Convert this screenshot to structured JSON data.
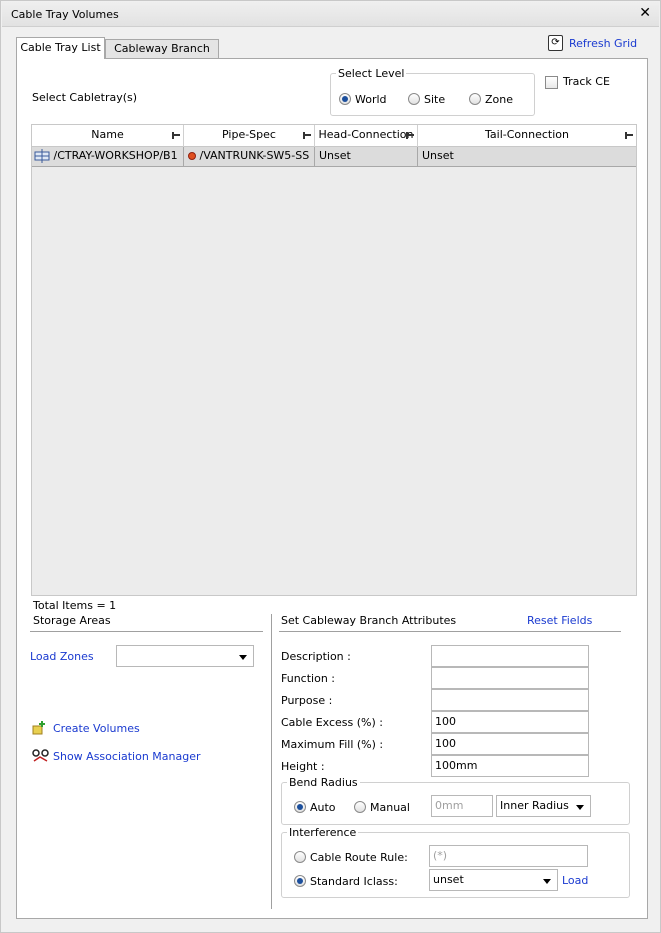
{
  "window": {
    "title": "Cable Tray Volumes"
  },
  "tabs": [
    {
      "label": "Cable Tray List",
      "active": true
    },
    {
      "label": "Cableway Branch List",
      "active": false
    }
  ],
  "refresh_label": "Refresh Grid",
  "select_cabletray_label": "Select Cabletray(s)",
  "select_level": {
    "title": "Select Level",
    "options": [
      "World",
      "Site",
      "Zone"
    ],
    "selected": "World"
  },
  "track_ce_label": "Track CE",
  "grid": {
    "columns": [
      "Name",
      "Pipe-Spec",
      "Head-Connection",
      "Tail-Connection"
    ],
    "rows": [
      {
        "name": "/CTRAY-WORKSHOP/B1",
        "pipe_spec": "/VANTRUNK-SW5-SS",
        "head": "Unset",
        "tail": "Unset"
      }
    ]
  },
  "total_items": "Total Items = 1",
  "storage_areas_label": "Storage Areas",
  "load_zones_label": "Load Zones",
  "create_volumes_label": "Create Volumes",
  "show_association_label": "Show Association Manager",
  "attributes": {
    "title": "Set Cableway Branch Attributes",
    "reset_label": "Reset Fields",
    "description_label": "Description :",
    "function_label": "Function :",
    "purpose_label": "Purpose :",
    "cable_excess_label": "Cable Excess (%) :",
    "cable_excess_value": "100",
    "max_fill_label": "Maximum Fill (%) :",
    "max_fill_value": "100",
    "height_label": "Height :",
    "height_value": "100mm"
  },
  "bend_radius": {
    "title": "Bend Radius",
    "auto_label": "Auto",
    "manual_label": "Manual",
    "selected": "Auto",
    "value_placeholder": "0mm",
    "type_value": "Inner Radius"
  },
  "interference": {
    "title": "Interference",
    "route_rule_label": "Cable Route Rule:",
    "route_rule_placeholder": "(*)",
    "standard_iclass_label": "Standard Iclass:",
    "iclass_value": "unset",
    "selected": "Standard Iclass",
    "load_label": "Load"
  },
  "colors": {
    "link": "#1a3ad0",
    "radio_selected": "#1c4f9c"
  }
}
